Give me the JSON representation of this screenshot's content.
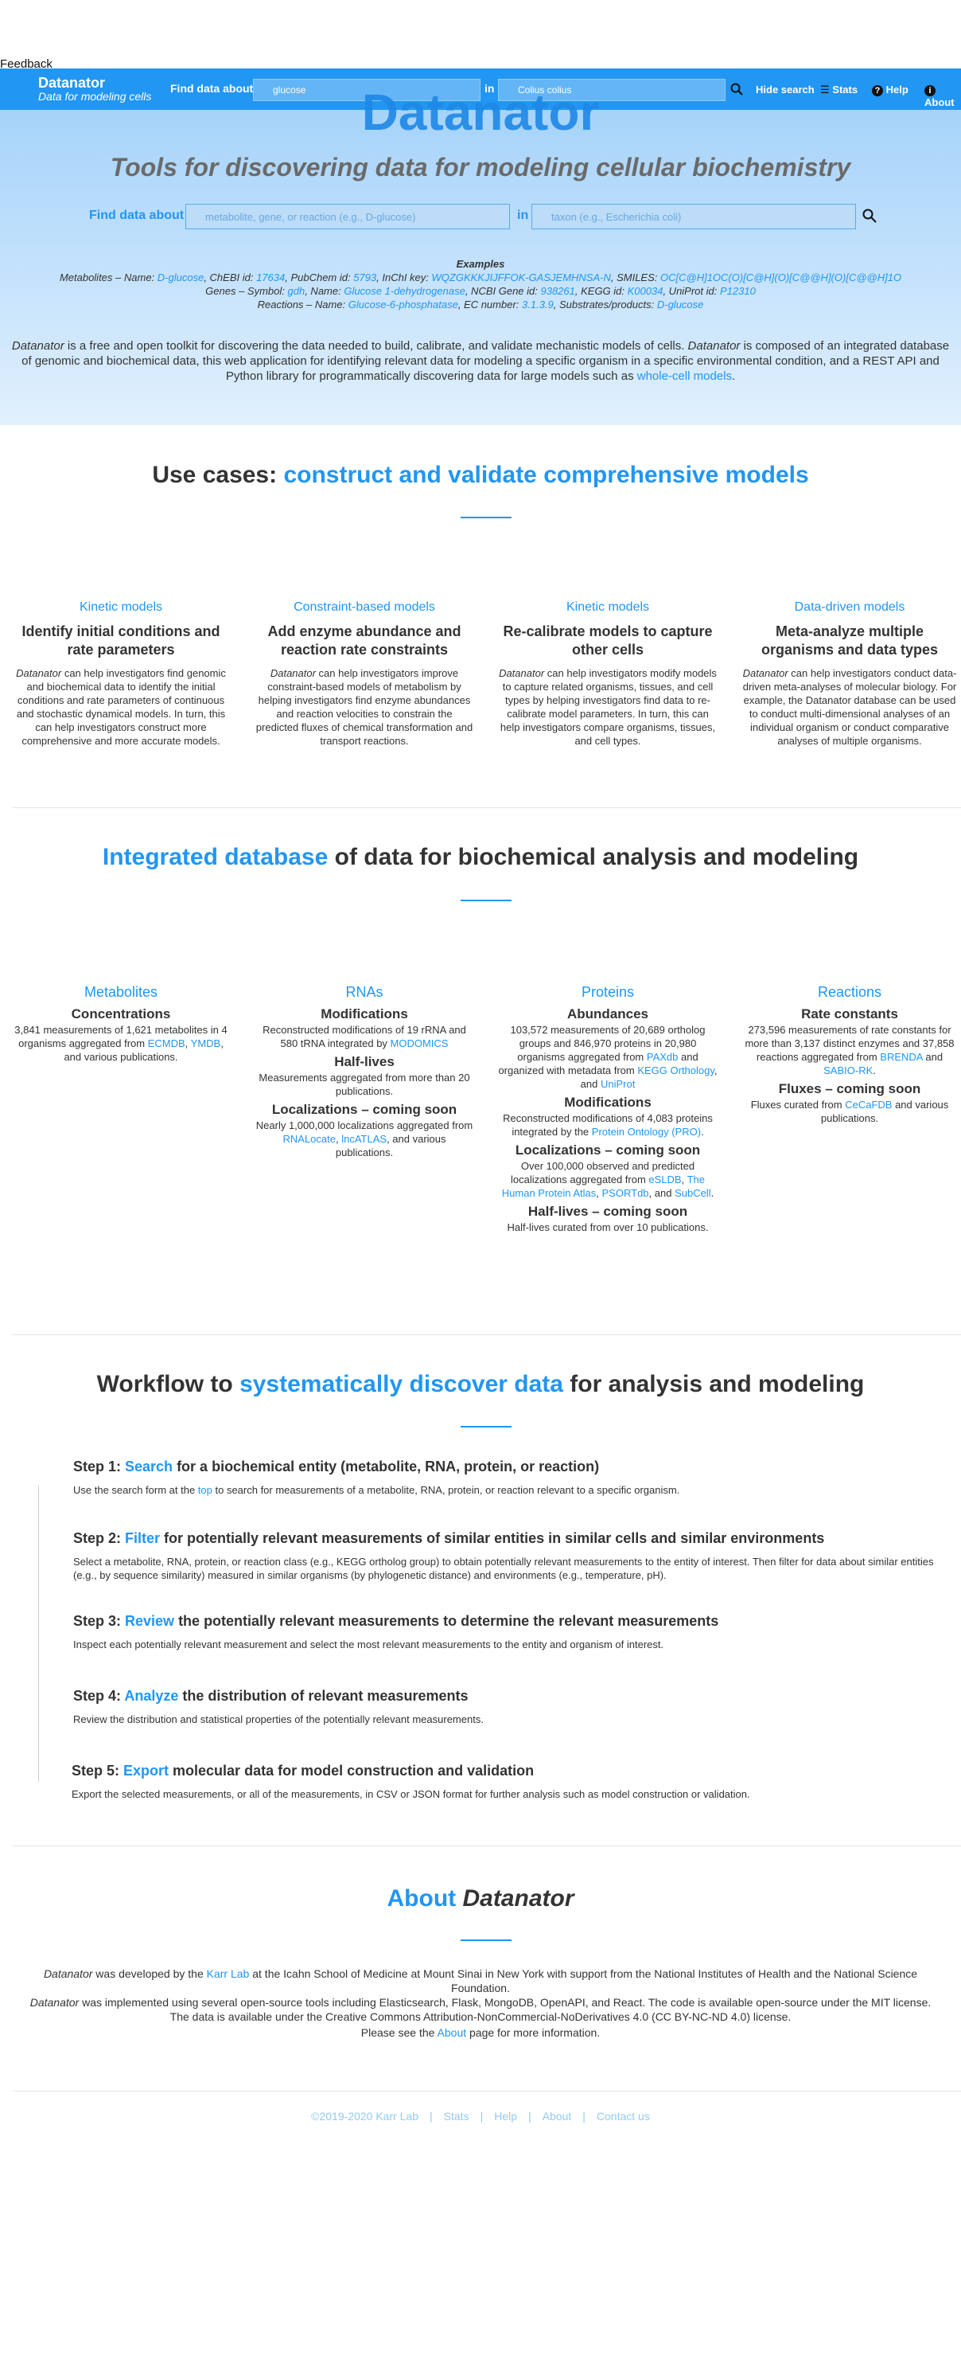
{
  "feedback": "Feedback",
  "nav": {
    "brand_title": "Datanator",
    "brand_subtitle": "Data for modeling cells",
    "find_label": "Find data about",
    "query_value": "glucose",
    "in_label": "in",
    "organism_value": "Colius colius",
    "hide_search": "Hide search",
    "stats": "Stats",
    "help": "Help",
    "about": "About"
  },
  "hero": {
    "logo": "Datanator",
    "tagline": "Tools for discovering data for modeling cellular biochemistry",
    "find_label": "Find data about",
    "query_placeholder": "metabolite, gene, or reaction (e.g., D-glucose)",
    "in_label": "in",
    "organism_placeholder": "taxon (e.g., Escherichia coli)",
    "examples_heading": "Examples",
    "examples": {
      "metabolites_prefix": "Metabolites – Name: ",
      "metabolites_name": "D-glucose",
      "chebi_label": ", ChEBI id: ",
      "chebi": "17634",
      "pubchem_label": ", PubChem id: ",
      "pubchem": "5793",
      "inchi_label": ", InChI key: ",
      "inchi": "WQZGKKKJIJFFOK-GASJEMHNSA-N",
      "smiles_label": ", SMILES: ",
      "smiles": "OC[C@H]1OC(O)[C@H](O)[C@@H](O)[C@@H]1O",
      "genes_prefix": "Genes – Symbol: ",
      "gene_symbol": "gdh",
      "gene_name_label": ", Name: ",
      "gene_name": "Glucose 1-dehydrogenase",
      "ncbi_label": ", NCBI Gene id: ",
      "ncbi": "938261",
      "kegg_label": ", KEGG id: ",
      "kegg": "K00034",
      "uniprot_label": ", UniProt id: ",
      "uniprot": "P12310",
      "reactions_prefix": "Reactions – Name: ",
      "reaction_name": "Glucose-6-phosphatase",
      "ec_label": ", EC number: ",
      "ec": "3.1.3.9",
      "substrates_label": ", Substrates/products: ",
      "substrate": "D-glucose"
    },
    "intro_1": "Datanator",
    "intro_2": " is a free and open toolkit for discovering the data needed to build, calibrate, and validate mechanistic models of cells. ",
    "intro_3": "Datanator",
    "intro_4": " is composed of an integrated database of genomic and biochemical data, this web application for identifying relevant data for modeling a specific organism in a specific environmental condition, and a REST API and Python library for programmatically discovering data for large models such as ",
    "intro_link": "whole-cell models",
    "intro_end": "."
  },
  "use_cases": {
    "title_plain": "Use cases: ",
    "title_accent": "construct and validate comprehensive models",
    "items": [
      {
        "category": "Kinetic models",
        "heading": "Identify initial conditions and rate parameters",
        "em": "Datanator",
        "body": " can help investigators find genomic and biochemical data to identify the initial conditions and rate parameters of continuous and stochastic dynamical models. In turn, this can help investigators construct more comprehensive and more accurate models."
      },
      {
        "category": "Constraint-based models",
        "heading": "Add enzyme abundance and reaction rate constraints",
        "em": "Datanator",
        "body": " can help investigators improve constraint-based models of metabolism by helping investigators find enzyme abundances and reaction velocities to constrain the predicted fluxes of chemical transformation and transport reactions."
      },
      {
        "category": "Kinetic models",
        "heading": "Re-calibrate models to capture other cells",
        "em": "Datanator",
        "body": " can help investigators modify models to capture related organisms, tissues, and cell types by helping investigators find data to re-calibrate model parameters. In turn, this can help investigators compare organisms, tissues, and cell types."
      },
      {
        "category": "Data-driven models",
        "heading": "Meta-analyze multiple organisms and data types",
        "em": "Datanator",
        "body": " can help investigators conduct data-driven meta-analyses of molecular biology. For example, the Datanator database can be used to conduct multi-dimensional analyses of an individual organism or conduct comparative analyses of multiple organisms."
      }
    ]
  },
  "database": {
    "title_accent": "Integrated database",
    "title_plain": " of data for biochemical analysis and modeling",
    "metabolites": {
      "category": "Metabolites",
      "conc_title": "Concentrations",
      "conc_text": "3,841 measurements of 1,621 metabolites in 4 organisms aggregated from ",
      "ecmdb": "ECMDB",
      "sep": ", ",
      "ymdb": "YMDB",
      "conc_end": ", and various publications."
    },
    "rnas": {
      "category": "RNAs",
      "mod_title": "Modifications",
      "mod_text": "Reconstructed modifications of 19 rRNA and 580 tRNA integrated by ",
      "modomics": "MODOMICS",
      "hl_title": "Half-lives",
      "hl_text": "Measurements aggregated from more than 20 publications.",
      "loc_title": "Localizations – coming soon",
      "loc_text": "Nearly 1,000,000 localizations aggregated from ",
      "rnalocate": "RNALocate",
      "sep": ", ",
      "lncatlas": "lncATLAS",
      "loc_end": ", and various publications."
    },
    "proteins": {
      "category": "Proteins",
      "ab_title": "Abundances",
      "ab_text": "103,572 measurements of 20,689 ortholog groups and 846,970 proteins in 20,980 organisms aggregated from ",
      "paxdb": "PAXdb",
      "ab_mid": " and organized with metadata from ",
      "kegg": "KEGG Orthology",
      "and": ", and ",
      "uniprot": "UniProt",
      "mod_title": "Modifications",
      "mod_text": "Reconstructed modifications of 4,083 proteins integrated by the ",
      "pro": "Protein Ontology (PRO)",
      "dot": ".",
      "loc_title": "Localizations – coming soon",
      "loc_text": "Over 100,000 observed and predicted localizations aggregated from ",
      "esldb": "eSLDB",
      "c1": ", ",
      "hpa": "The Human Protein Atlas",
      "c2": ", ",
      "psort": "PSORTdb",
      "and2": ", and ",
      "subcell": "SubCell",
      "dot2": ".",
      "hl_title": "Half-lives – coming soon",
      "hl_text": "Half-lives curated from over 10 publications."
    },
    "reactions": {
      "category": "Reactions",
      "rc_title": "Rate constants",
      "rc_text": "273,596 measurements of rate constants for more than 3,137 distinct enzymes and 37,858 reactions aggregated from ",
      "brenda": "BRENDA",
      "and": " and ",
      "sabio": "SABIO-RK",
      "dot": ".",
      "fl_title": "Fluxes – coming soon",
      "fl_text": "Fluxes curated from ",
      "cecafdb": "CeCaFDB",
      "fl_end": " and various publications."
    }
  },
  "workflow": {
    "title_plain_1": "Workflow to ",
    "title_accent": "systematically discover data",
    "title_plain_2": " for analysis and modeling",
    "steps": [
      {
        "prefix": "Step 1: ",
        "verb": "Search",
        "rest": " for a biochemical entity (metabolite, RNA, protein, or reaction)",
        "body_1": "Use the search form at the ",
        "link": "top",
        "body_2": " to search for measurements of a metabolite, RNA, protein, or reaction relevant to a specific organism."
      },
      {
        "prefix": "Step 2: ",
        "verb": "Filter",
        "rest": " for potentially relevant measurements of similar entities in similar cells and similar environments",
        "body_1": "Select a metabolite, RNA, protein, or reaction class (e.g., KEGG ortholog group) to obtain potentially relevant measurements to the entity of interest. Then filter for data about similar entities (e.g., by sequence similarity) measured in similar organisms (by phylogenetic distance) and environments (e.g., temperature, pH).",
        "link": "",
        "body_2": ""
      },
      {
        "prefix": "Step 3: ",
        "verb": "Review",
        "rest": " the potentially relevant measurements to determine the relevant measurements",
        "body_1": "Inspect each potentially relevant measurement and select the most relevant measurements to the entity and organism of interest.",
        "link": "",
        "body_2": ""
      },
      {
        "prefix": "Step 4: ",
        "verb": "Analyze",
        "rest": " the distribution of relevant measurements",
        "body_1": "Review the distribution and statistical properties of the potentially relevant measurements.",
        "link": "",
        "body_2": ""
      },
      {
        "prefix": "Step 5: ",
        "verb": "Export",
        "rest": " molecular data for model construction and validation",
        "body_1": "Export the selected measurements, or all of the measurements, in CSV or JSON format for further analysis such as model construction or validation.",
        "link": "",
        "body_2": ""
      }
    ]
  },
  "about": {
    "title_accent": "About ",
    "title_em": "Datanator",
    "p1_em": "Datanator",
    "p1_a": " was developed by the ",
    "p1_link": "Karr Lab",
    "p1_b": " at the Icahn School of Medicine at Mount Sinai in New York with support from the National Institutes of Health and the National Science Foundation.",
    "p2_em": "Datanator",
    "p2": " was implemented using several open-source tools including Elasticsearch, Flask, MongoDB, OpenAPI, and React. The code is available open-source under the MIT license. The data is available under the Creative Commons Attribution-NonCommercial-NoDerivatives 4.0 (CC BY-NC-ND 4.0) license.",
    "p3_a": "Please see the ",
    "p3_link": "About",
    "p3_b": " page for more information."
  },
  "footer": {
    "copyright": "©2019-2020 Karr Lab",
    "stats": "Stats",
    "help": "Help",
    "about": "About",
    "contact": "Contact us",
    "separator": "|"
  },
  "colors": {
    "accent": "#2196f3",
    "navbar": "#2196f3",
    "text": "#333333"
  }
}
